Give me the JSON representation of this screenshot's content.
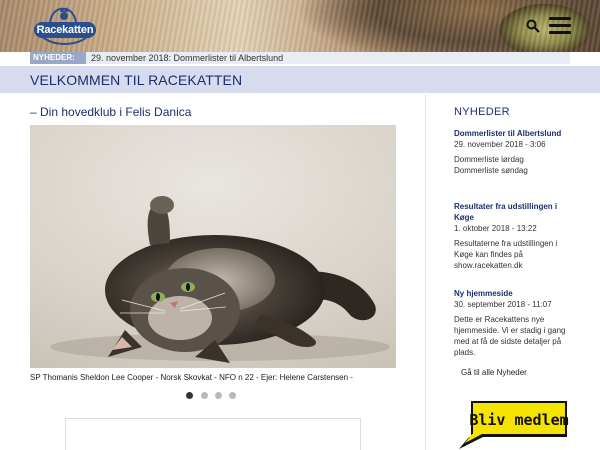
{
  "header": {
    "logo_text": "Racekatten",
    "icons": [
      "cat-logo-icon",
      "search-icon",
      "menu-icon"
    ]
  },
  "ticker": {
    "label": "NYHEDER:",
    "text": "29. november 2018: Dommerlister til Albertslund"
  },
  "welcome_title": "VELKOMMEN TIL RACEKATTEN",
  "main": {
    "subtitle": "– Din hovedklub i Felis Danica",
    "slide_caption": "SP Thomanis Sheldon Lee Cooper - Norsk Skovkat - NFO n 22 - Ejer: Helene Carstensen -",
    "slide_count": 4,
    "active_slide": 1
  },
  "sidebar": {
    "title": "NYHEDER",
    "news": [
      {
        "headline": "Dommerlister til Albertslund",
        "date": "29. november 2018 - 3:06",
        "body": [
          "Dommerliste lørdag",
          "Dommerliste søndag"
        ]
      },
      {
        "headline": "Resultater fra udstillingen i Køge",
        "date": "1. oktober 2018 - 13:22",
        "body": [
          "Resultaterne fra udstillingen i Køge kan findes på show.racekatten.dk"
        ]
      },
      {
        "headline": "Ny hjemmeside",
        "date": "30. september 2018 - 11:07",
        "body": [
          "Dette er Racekattens nye hjemmeside. Vi er stadig i gang med at få de sidste detaljer på plads."
        ]
      }
    ],
    "all_news_link": "Gå til alle Nyheder",
    "join_button": "Bliv medlem"
  },
  "colors": {
    "brand_blue": "#1b2f6e",
    "welcome_bar": "#d6dcee",
    "ticker_label": "#9aa8c8",
    "join_yellow": "#f5e400"
  }
}
